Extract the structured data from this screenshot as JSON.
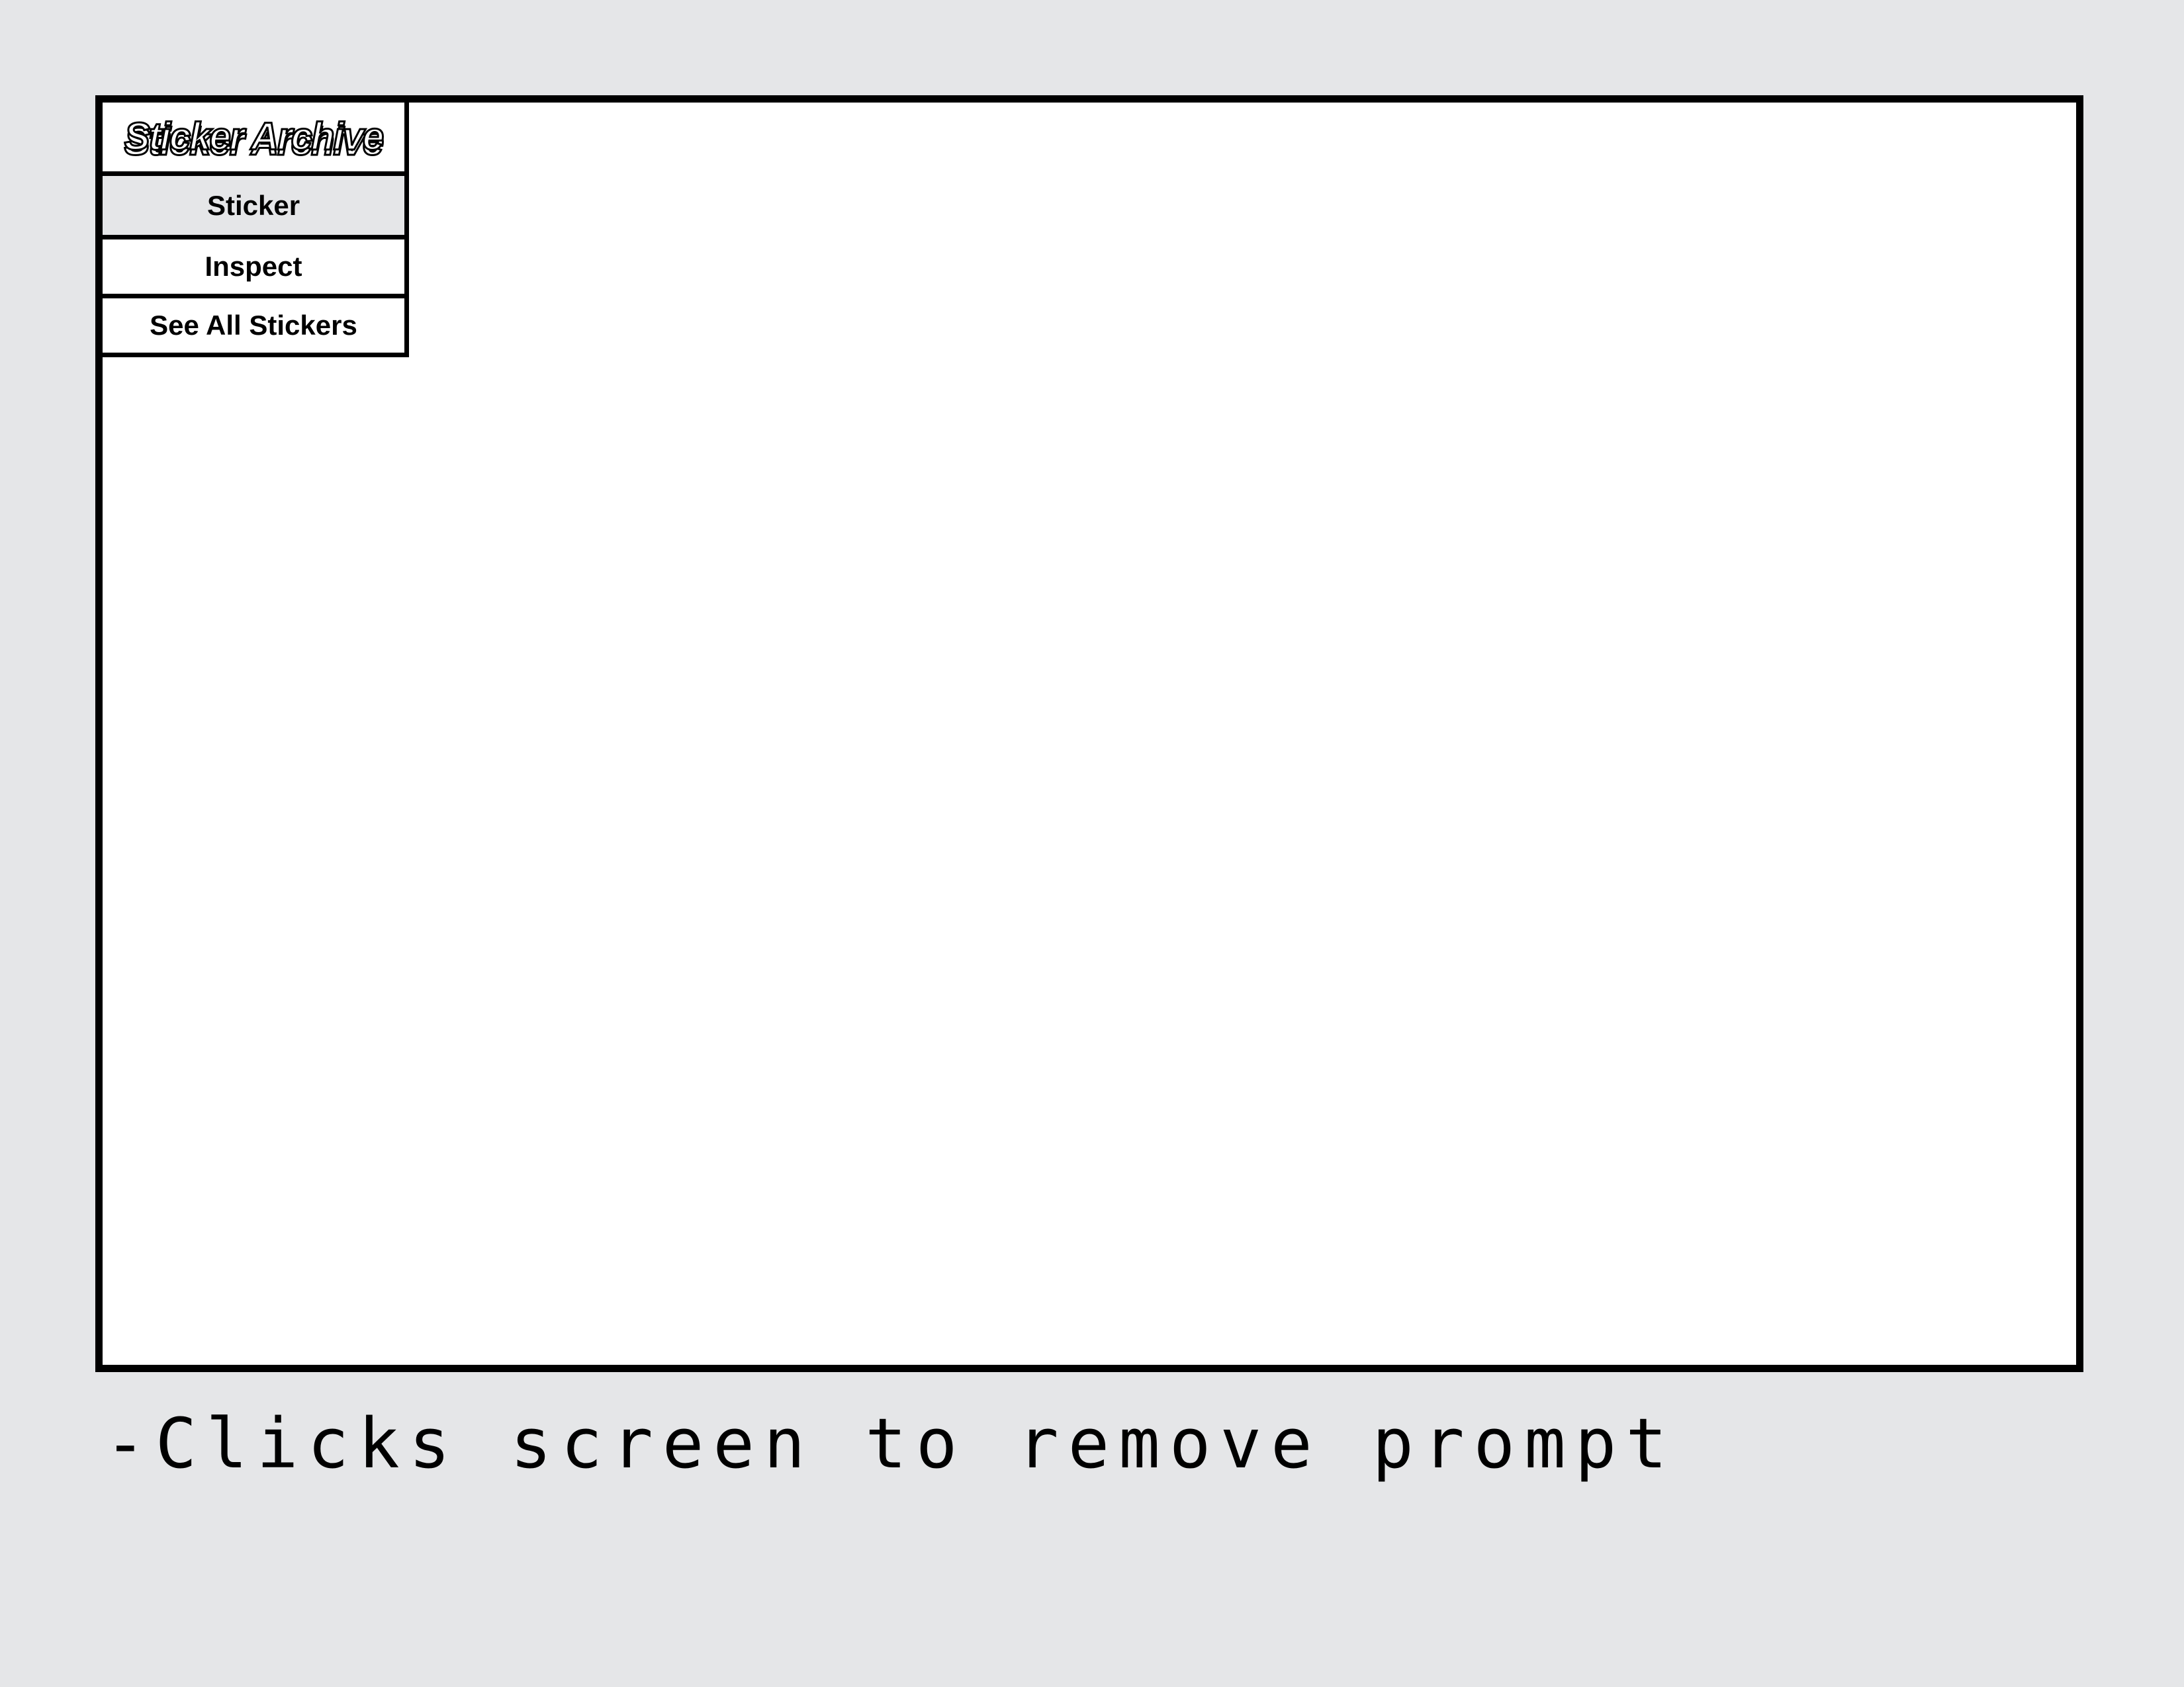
{
  "app": {
    "logo_text": "Sticker Archive"
  },
  "menu": {
    "items": [
      {
        "label": "Sticker",
        "active": true
      },
      {
        "label": "Inspect",
        "active": false
      },
      {
        "label": "See All Stickers",
        "active": false
      }
    ]
  },
  "caption": {
    "text": "-Clicks screen to remove prompt"
  },
  "colors": {
    "background": "#e5e6e8",
    "frame_border": "#000000",
    "canvas": "#ffffff",
    "active_item": "#e5e6e8"
  }
}
